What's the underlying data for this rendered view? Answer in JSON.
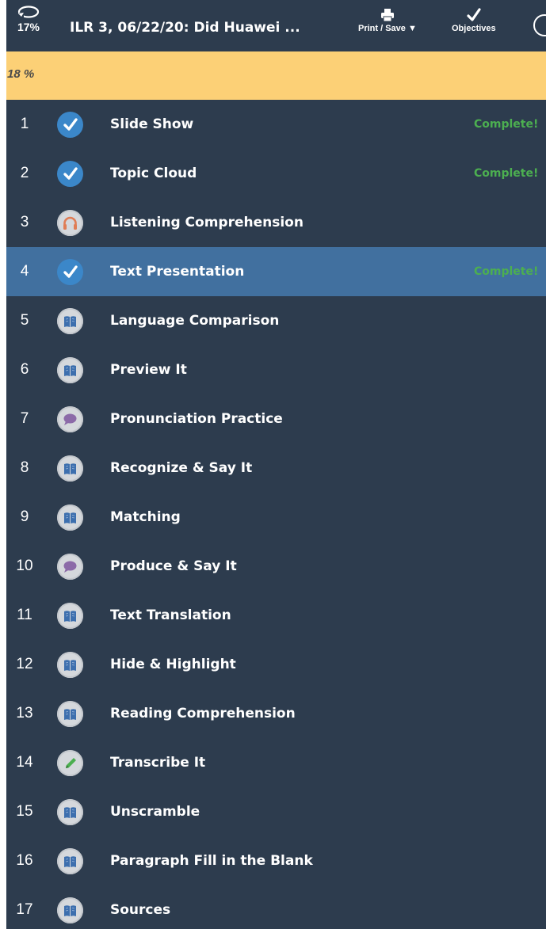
{
  "header": {
    "progress_percent": "17%",
    "lesson_title": "ILR 3, 06/22/20: Did Huawei ...",
    "print_save_label": "Print / Save",
    "objectives_label": "Objectives"
  },
  "progress_bar": {
    "text": "18 %",
    "fraction": 0.18,
    "color": "#fcd076"
  },
  "colors": {
    "panel": "#2d3c4e",
    "active_row": "#41709f",
    "complete_text": "#4caf50",
    "done_icon": "#3b87c9"
  },
  "activities": [
    {
      "num": "1",
      "label": "Slide Show",
      "status": "Complete!",
      "icon": "check-icon"
    },
    {
      "num": "2",
      "label": "Topic Cloud",
      "status": "Complete!",
      "icon": "check-icon"
    },
    {
      "num": "3",
      "label": "Listening Comprehension",
      "status": "",
      "icon": "headphones-icon"
    },
    {
      "num": "4",
      "label": "Text Presentation",
      "status": "Complete!",
      "icon": "check-icon",
      "active": true
    },
    {
      "num": "5",
      "label": "Language Comparison",
      "status": "",
      "icon": "book-icon"
    },
    {
      "num": "6",
      "label": "Preview It",
      "status": "",
      "icon": "book-icon"
    },
    {
      "num": "7",
      "label": "Pronunciation Practice",
      "status": "",
      "icon": "speech-bubble-icon"
    },
    {
      "num": "8",
      "label": "Recognize & Say It",
      "status": "",
      "icon": "book-icon"
    },
    {
      "num": "9",
      "label": "Matching",
      "status": "",
      "icon": "book-icon"
    },
    {
      "num": "10",
      "label": "Produce & Say It",
      "status": "",
      "icon": "speech-bubble-icon"
    },
    {
      "num": "11",
      "label": "Text Translation",
      "status": "",
      "icon": "book-icon"
    },
    {
      "num": "12",
      "label": "Hide & Highlight",
      "status": "",
      "icon": "book-icon"
    },
    {
      "num": "13",
      "label": "Reading Comprehension",
      "status": "",
      "icon": "book-icon"
    },
    {
      "num": "14",
      "label": "Transcribe It",
      "status": "",
      "icon": "pencil-icon"
    },
    {
      "num": "15",
      "label": "Unscramble",
      "status": "",
      "icon": "book-icon"
    },
    {
      "num": "16",
      "label": "Paragraph Fill in the Blank",
      "status": "",
      "icon": "book-icon"
    },
    {
      "num": "17",
      "label": "Sources",
      "status": "",
      "icon": "book-icon"
    }
  ]
}
